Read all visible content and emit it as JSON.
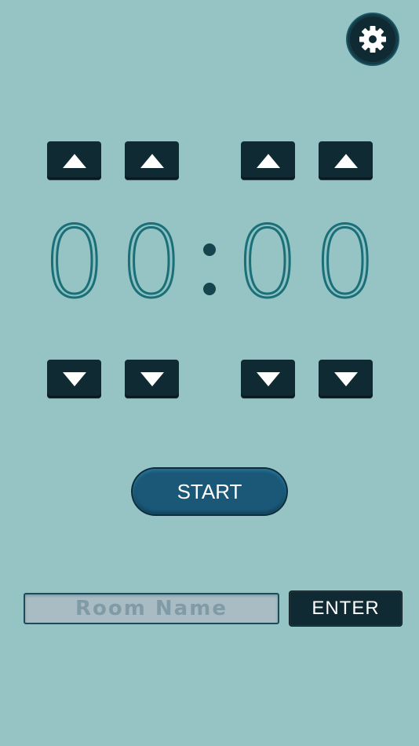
{
  "settings": {
    "icon": "gear-icon"
  },
  "timer": {
    "digits": [
      "0",
      "0",
      "0",
      "0"
    ],
    "separator": ":"
  },
  "controls": {
    "up_icon": "triangle-up-icon",
    "down_icon": "triangle-down-icon"
  },
  "start_label": "START",
  "room": {
    "placeholder": "Room Name",
    "value": ""
  },
  "enter_label": "ENTER",
  "colors": {
    "background": "#96c4c4",
    "button_dark": "#0f2a32",
    "start_button": "#1b5878",
    "digit_outline": "#1a6f78"
  }
}
